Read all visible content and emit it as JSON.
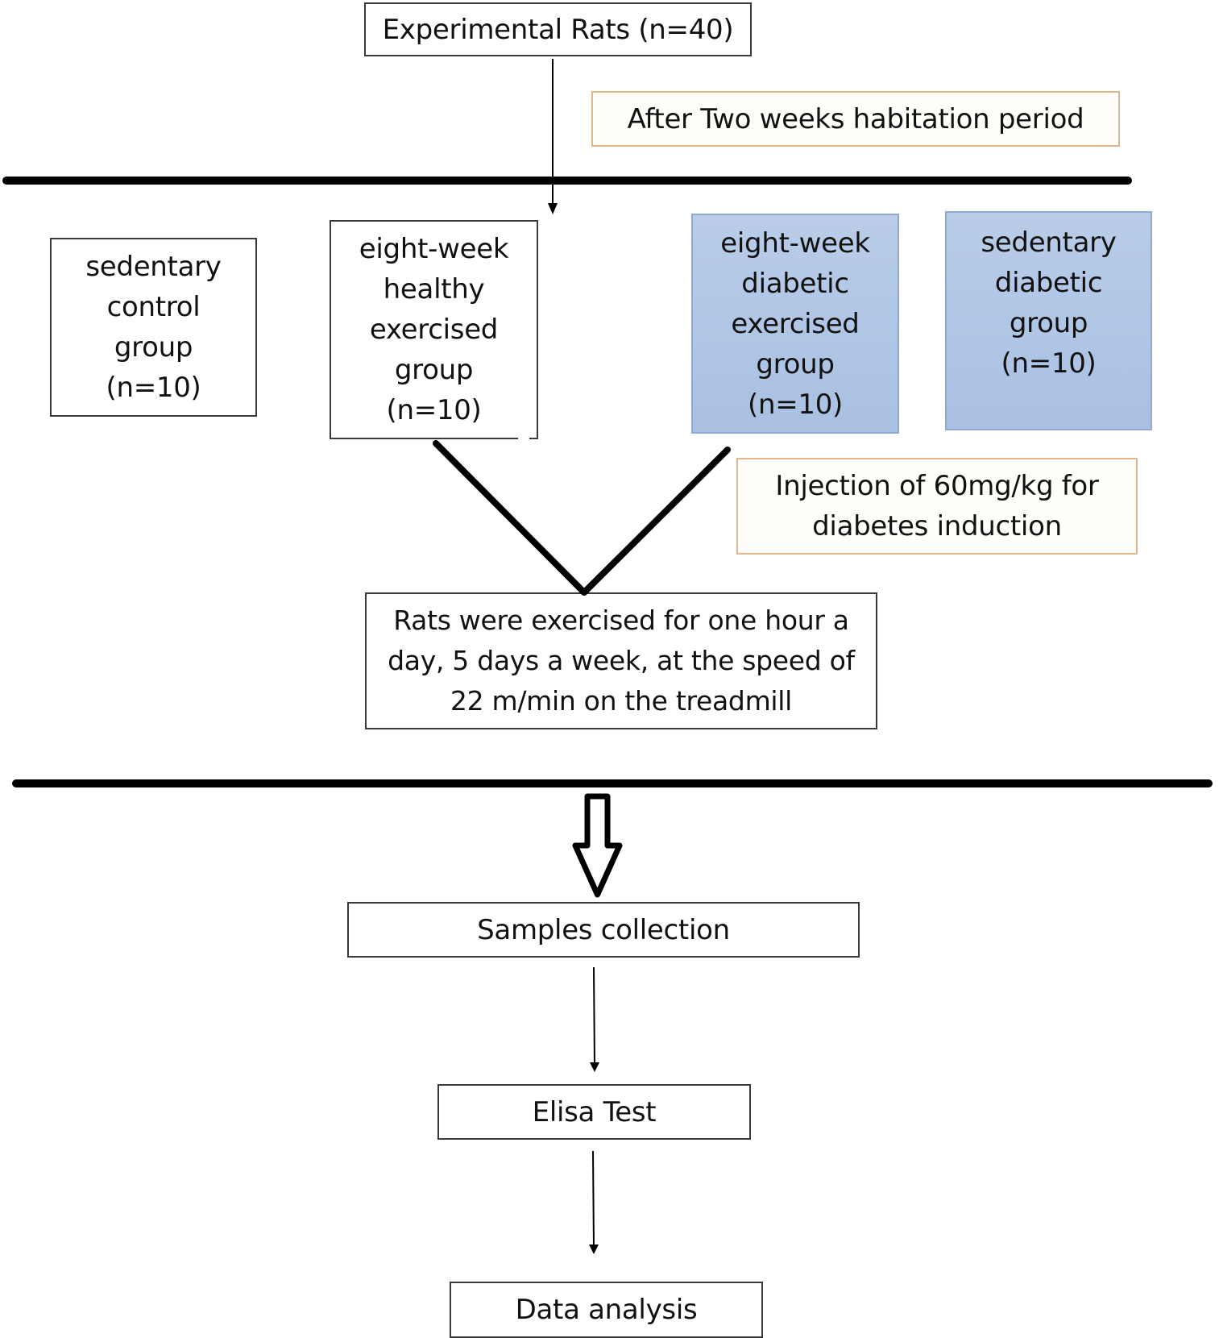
{
  "diagram": {
    "title_box": "Experimental Rats (n=40)",
    "habituation_note": "After Two weeks habitation period",
    "groups": [
      {
        "label": "sedentary\ncontrol\ngroup\n(n=10)",
        "style": "plain"
      },
      {
        "label": "eight-week\nhealthy\nexercised\ngroup\n(n=10)",
        "style": "plain"
      },
      {
        "label": "eight-week\ndiabetic\nexercised\ngroup\n(n=10)",
        "style": "blue"
      },
      {
        "label": "sedentary\ndiabetic\ngroup\n(n=10)",
        "style": "blue"
      }
    ],
    "injection_note": "Injection of 60mg/kg for\ndiabetes induction",
    "exercise_protocol": "Rats were exercised for one hour a\nday, 5 days a week, at the speed of\n22 m/min on the treadmill",
    "steps": [
      "Samples collection",
      "Elisa Test",
      "Data analysis"
    ],
    "colors": {
      "note_border": "#e2b68c",
      "diabetic_fill": "#b2c7e6",
      "diabetic_border": "#8fa9cf",
      "line": "#000000"
    }
  }
}
